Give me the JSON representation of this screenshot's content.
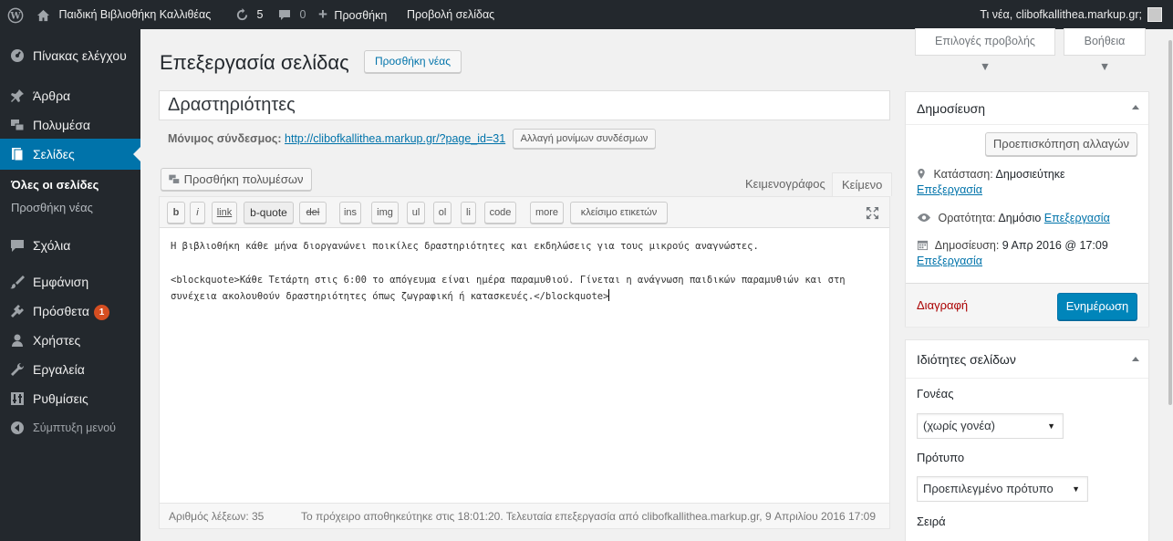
{
  "adminbar": {
    "site_name": "Παιδική Βιβλιοθήκη Καλλιθέας",
    "updates_count": "5",
    "comments_count": "0",
    "new_label": "Προσθήκη",
    "view_label": "Προβολή σελίδας",
    "greeting": "Τι νέα, clibofkallithea.markup.gr;"
  },
  "sidebar": {
    "items": [
      {
        "label": "Πίνακας ελέγχου",
        "icon": "dashboard-icon"
      },
      {
        "label": "Άρθρα",
        "icon": "pin-icon"
      },
      {
        "label": "Πολυμέσα",
        "icon": "media-icon"
      },
      {
        "label": "Σελίδες",
        "icon": "page-icon"
      },
      {
        "label": "Σχόλια",
        "icon": "comment-icon"
      },
      {
        "label": "Εμφάνιση",
        "icon": "brush-icon"
      },
      {
        "label": "Πρόσθετα",
        "icon": "plugin-icon"
      },
      {
        "label": "Χρήστες",
        "icon": "users-icon"
      },
      {
        "label": "Εργαλεία",
        "icon": "wrench-icon"
      },
      {
        "label": "Ρυθμίσεις",
        "icon": "settings-icon"
      },
      {
        "label": "Σύμπτυξη μενού",
        "icon": "collapse-icon"
      }
    ],
    "submenu": [
      "Όλες οι σελίδες",
      "Προσθήκη νέας"
    ],
    "plugins_badge": "1"
  },
  "screen_tabs": {
    "options": "Επιλογές προβολής ▼",
    "help": "Βοήθεια ▼"
  },
  "page": {
    "title": "Επεξεργασία σελίδας",
    "add_new": "Προσθήκη νέας",
    "post_title": "Δραστηριότητες",
    "permalink_label": "Μόνιμος σύνδεσμος:",
    "permalink_url": "http://clibofkallithea.markup.gr/?page_id=31",
    "permalink_button": "Αλλαγή μονίμων συνδέσμων"
  },
  "editor": {
    "add_media": "Προσθήκη πολυμέσων",
    "tab_visual": "Κειμενογράφος",
    "tab_text": "Κείμενο",
    "quicktags": [
      "b",
      "i",
      "link",
      "b-quote",
      "del",
      "ins",
      "img",
      "ul",
      "ol",
      "li",
      "code",
      "more",
      "κλείσιμο ετικετών"
    ],
    "content_p1": "Η βιβλιοθήκη κάθε μήνα διοργανώνει ποικίλες δραστηριότητες και εκδηλώσεις για τους μικρούς αναγνώστες.",
    "content_p2_line1": "<blockquote>Κάθε Τετάρτη στις 6:00 το απόγευμα είναι ημέρα παραμυθιού. Γίνεται η ανάγνωση παιδικών παραμυθιών και στη",
    "content_p2_line2": "συνέχεια ακολουθούν δραστηριότητες όπως ζωγραφική ή κατασκευές.</blockquote>",
    "word_count": "Αριθμός λέξεων: 35",
    "autosave": "Το πρόχειρο αποθηκεύτηκε στις 18:01:20. Τελευταία επεξεργασία από clibofkallithea.markup.gr, 9 Απριλίου 2016 17:09"
  },
  "publish": {
    "heading": "Δημοσίευση",
    "preview": "Προεπισκόπηση αλλαγών",
    "status_label": "Κατάσταση:",
    "status_value": "Δημοσιεύτηκε",
    "visibility_label": "Ορατότητα:",
    "visibility_value": "Δημόσιο",
    "published_label": "Δημοσίευση:",
    "published_value": "9 Απρ 2016 @ 17:09",
    "edit": "Επεξεργασία",
    "trash": "Διαγραφή",
    "update": "Ενημέρωση"
  },
  "attributes": {
    "heading": "Ιδιότητες σελίδων",
    "parent_label": "Γονέας",
    "parent_value": "(χωρίς γονέα)",
    "template_label": "Πρότυπο",
    "template_value": "Προεπιλεγμένο πρότυπο",
    "order_label": "Σειρά"
  },
  "colors": {
    "accent": "#0073aa",
    "adminbar": "#23282d",
    "badge": "#d54e21",
    "background": "#f1f1f1"
  }
}
